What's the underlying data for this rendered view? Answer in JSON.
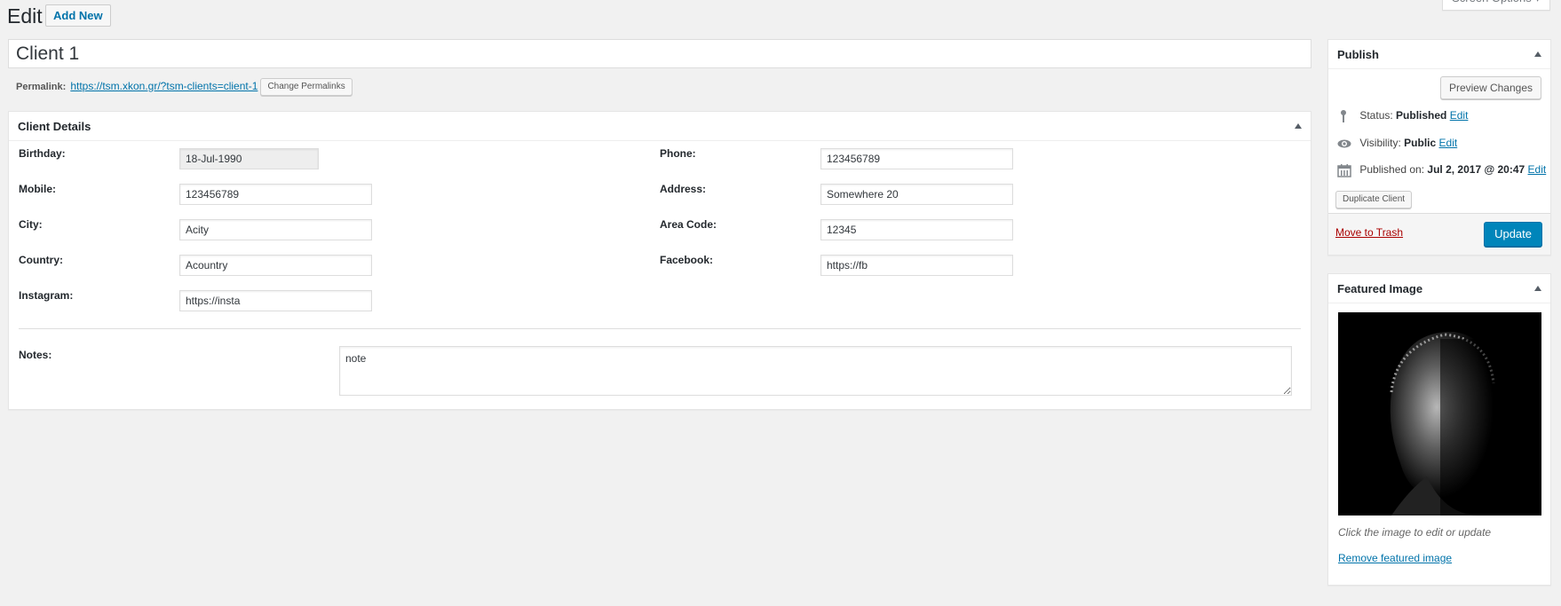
{
  "header": {
    "title": "Edit",
    "add_new_label": "Add New",
    "screen_options_label": "Screen Options ▾"
  },
  "post": {
    "title_value": "Client 1",
    "permalink_label": "Permalink:",
    "permalink_url": "https://tsm.xkon.gr/?tsm-clients=client-1",
    "change_permalinks_label": "Change Permalinks"
  },
  "client_details": {
    "heading": "Client Details",
    "left_fields": [
      {
        "label": "Birthday:",
        "value": "18-Jul-1990",
        "readonly": true
      },
      {
        "label": "Mobile:",
        "value": "123456789"
      },
      {
        "label": "City:",
        "value": "Acity"
      },
      {
        "label": "Country:",
        "value": "Acountry"
      },
      {
        "label": "Instagram:",
        "value": "https://insta"
      }
    ],
    "right_fields": [
      {
        "label": "Phone:",
        "value": "123456789"
      },
      {
        "label": "Address:",
        "value": "Somewhere 20"
      },
      {
        "label": "Area Code:",
        "value": "12345"
      },
      {
        "label": "Facebook:",
        "value": "https://fb"
      }
    ],
    "notes": {
      "label": "Notes:",
      "value": "note"
    }
  },
  "publish": {
    "heading": "Publish",
    "preview_label": "Preview Changes",
    "status_label": "Status:",
    "status_value": "Published",
    "visibility_label": "Visibility:",
    "visibility_value": "Public",
    "published_on_label": "Published on:",
    "published_on_value": "Jul 2, 2017 @ 20:47",
    "edit_label": "Edit",
    "duplicate_label": "Duplicate Client",
    "trash_label": "Move to Trash",
    "update_label": "Update",
    "colors": {
      "primary": "#0085ba",
      "trash": "#aa0000",
      "link": "#0073aa"
    }
  },
  "featured_image": {
    "heading": "Featured Image",
    "caption": "Click the image to edit or update",
    "remove_label": "Remove featured image"
  }
}
